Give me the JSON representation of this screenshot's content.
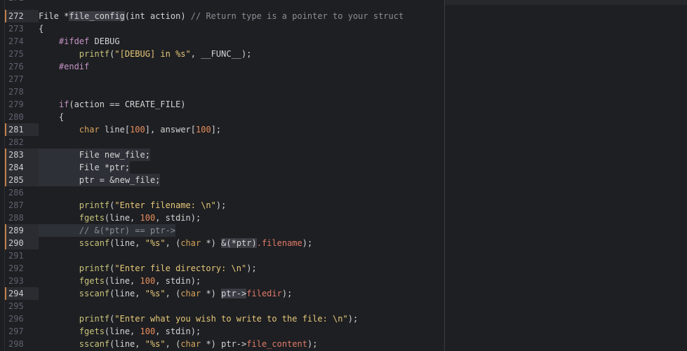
{
  "editor": {
    "top_clipped_line": "271",
    "lines": [
      {
        "n": "272",
        "mod": true,
        "html": [
          [
            "plain",
            "File *"
          ],
          [
            "hl",
            "file_config"
          ],
          [
            "plain",
            "(int action) "
          ],
          [
            "cm",
            "// Return type is a pointer to your struct"
          ]
        ]
      },
      {
        "n": "273",
        "html": [
          [
            "plain",
            "{"
          ]
        ]
      },
      {
        "n": "274",
        "html": [
          [
            "plain",
            "    "
          ],
          [
            "pp",
            "#ifdef"
          ],
          [
            "plain",
            " DEBUG"
          ]
        ]
      },
      {
        "n": "275",
        "html": [
          [
            "plain",
            "        "
          ],
          [
            "fn",
            "printf"
          ],
          [
            "plain",
            "("
          ],
          [
            "str",
            "\"[DEBUG] in %s\""
          ],
          [
            "plain",
            ", __FUNC__);"
          ]
        ]
      },
      {
        "n": "276",
        "html": [
          [
            "plain",
            "    "
          ],
          [
            "pp",
            "#endif"
          ]
        ]
      },
      {
        "n": "277",
        "html": []
      },
      {
        "n": "278",
        "html": []
      },
      {
        "n": "279",
        "html": [
          [
            "plain",
            "    "
          ],
          [
            "pp",
            "if"
          ],
          [
            "plain",
            "(action == CREATE_FILE)"
          ]
        ]
      },
      {
        "n": "280",
        "html": [
          [
            "plain",
            "    {"
          ]
        ]
      },
      {
        "n": "281",
        "mod": true,
        "html": [
          [
            "plain",
            "        "
          ],
          [
            "ty",
            "char"
          ],
          [
            "plain",
            " line["
          ],
          [
            "num-lit",
            "100"
          ],
          [
            "plain",
            "], answer["
          ],
          [
            "num-lit",
            "100"
          ],
          [
            "plain",
            "];"
          ]
        ]
      },
      {
        "n": "282",
        "html": []
      },
      {
        "n": "283",
        "mod": true,
        "sel": true,
        "html": [
          [
            "plain",
            "        File new_file;"
          ]
        ]
      },
      {
        "n": "284",
        "mod": true,
        "sel": true,
        "html": [
          [
            "plain",
            "        File *ptr;"
          ]
        ]
      },
      {
        "n": "285",
        "mod": true,
        "sel": true,
        "html": [
          [
            "plain",
            "        ptr = &new_file;"
          ]
        ]
      },
      {
        "n": "286",
        "html": []
      },
      {
        "n": "287",
        "html": [
          [
            "plain",
            "        "
          ],
          [
            "fn",
            "printf"
          ],
          [
            "plain",
            "("
          ],
          [
            "str",
            "\"Enter filename: \\n\""
          ],
          [
            "plain",
            ");"
          ]
        ]
      },
      {
        "n": "288",
        "html": [
          [
            "plain",
            "        "
          ],
          [
            "fn",
            "fgets"
          ],
          [
            "plain",
            "(line, "
          ],
          [
            "num-lit",
            "100"
          ],
          [
            "plain",
            ", stdin);"
          ]
        ]
      },
      {
        "n": "289",
        "mod": true,
        "sel": true,
        "html": [
          [
            "plain",
            "        "
          ],
          [
            "cm",
            "// &(*ptr) == ptr->"
          ]
        ]
      },
      {
        "n": "290",
        "mod": true,
        "html": [
          [
            "plain",
            "        "
          ],
          [
            "fn",
            "sscanf"
          ],
          [
            "plain",
            "(line, "
          ],
          [
            "str",
            "\"%s\""
          ],
          [
            "plain",
            ", ("
          ],
          [
            "ty",
            "char"
          ],
          [
            "plain",
            " *) "
          ],
          [
            "hl",
            "&(*ptr)"
          ],
          [
            "mem",
            ".filename"
          ],
          [
            "plain",
            ");"
          ]
        ]
      },
      {
        "n": "291",
        "html": []
      },
      {
        "n": "292",
        "html": [
          [
            "plain",
            "        "
          ],
          [
            "fn",
            "printf"
          ],
          [
            "plain",
            "("
          ],
          [
            "str",
            "\"Enter file directory: \\n\""
          ],
          [
            "plain",
            ");"
          ]
        ]
      },
      {
        "n": "293",
        "html": [
          [
            "plain",
            "        "
          ],
          [
            "fn",
            "fgets"
          ],
          [
            "plain",
            "(line, "
          ],
          [
            "num-lit",
            "100"
          ],
          [
            "plain",
            ", stdin);"
          ]
        ]
      },
      {
        "n": "294",
        "mod": true,
        "html": [
          [
            "plain",
            "        "
          ],
          [
            "fn",
            "sscanf"
          ],
          [
            "plain",
            "(line, "
          ],
          [
            "str",
            "\"%s\""
          ],
          [
            "plain",
            ", ("
          ],
          [
            "ty",
            "char"
          ],
          [
            "plain",
            " *) "
          ],
          [
            "hl",
            "ptr->"
          ],
          [
            "mem",
            "filedir"
          ],
          [
            "plain",
            ");"
          ]
        ]
      },
      {
        "n": "295",
        "html": []
      },
      {
        "n": "296",
        "html": [
          [
            "plain",
            "        "
          ],
          [
            "fn",
            "printf"
          ],
          [
            "plain",
            "("
          ],
          [
            "str",
            "\"Enter what you wish to write to the file: \\n\""
          ],
          [
            "plain",
            ");"
          ]
        ]
      },
      {
        "n": "297",
        "html": [
          [
            "plain",
            "        "
          ],
          [
            "fn",
            "fgets"
          ],
          [
            "plain",
            "(line, "
          ],
          [
            "num-lit",
            "100"
          ],
          [
            "plain",
            ", stdin);"
          ]
        ]
      },
      {
        "n": "298",
        "html": [
          [
            "plain",
            "        "
          ],
          [
            "fn",
            "sscanf"
          ],
          [
            "plain",
            "(line, "
          ],
          [
            "str",
            "\"%s\""
          ],
          [
            "plain",
            ", ("
          ],
          [
            "ty",
            "char"
          ],
          [
            "plain",
            " *) ptr->"
          ],
          [
            "mem",
            "file_content"
          ],
          [
            "plain",
            ");"
          ]
        ]
      }
    ]
  }
}
